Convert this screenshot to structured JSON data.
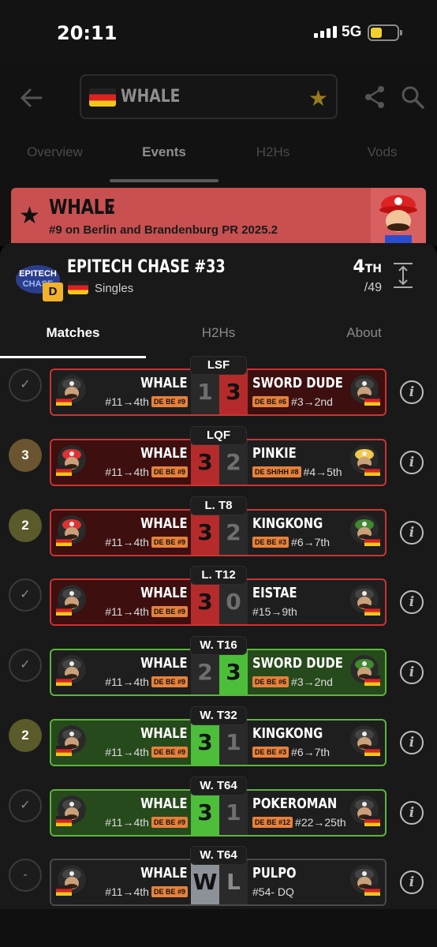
{
  "status": {
    "time": "20:11",
    "network": "5G"
  },
  "header": {
    "search_text": "WHALE",
    "tabs": [
      "Overview",
      "Events",
      "H2Hs",
      "Vods"
    ],
    "active_tab": 1
  },
  "banner": {
    "name": "WHALE",
    "subtitle": "#9 on Berlin and Brandenburg PR 2025.2"
  },
  "event": {
    "title": "EPITECH CHASE #33",
    "tier": "D",
    "type": "Singles",
    "placement": "4",
    "placement_suffix": "TH",
    "entrants": "/49",
    "tabs": [
      "Matches",
      "H2Hs",
      "About"
    ]
  },
  "colors": {
    "loss": "#b52b2b",
    "win": "#4cbe3a",
    "pr_badge": "#e8813a",
    "tier_badge": "#f0b22b"
  },
  "matches": [
    {
      "round": "LSF",
      "status": "check",
      "left": {
        "name": "WHALE",
        "pr": "DE BE #9",
        "seed": "#11→4th"
      },
      "score_left": "1",
      "score_right": "3",
      "right": {
        "name": "SWORD DUDE",
        "pr": "DE BE #6",
        "seed": "#3→2nd"
      }
    },
    {
      "round": "LQF",
      "status": "3",
      "left": {
        "name": "WHALE",
        "pr": "DE BE #9",
        "seed": "#11→4th"
      },
      "score_left": "3",
      "score_right": "2",
      "right": {
        "name": "PINKIE",
        "pr": "DE SH/HH #8",
        "seed": "#4→5th"
      }
    },
    {
      "round": "L. T8",
      "status": "2",
      "left": {
        "name": "WHALE",
        "pr": "DE BE #9",
        "seed": "#11→4th"
      },
      "score_left": "3",
      "score_right": "2",
      "right": {
        "name": "KINGKONG",
        "pr": "DE BE #3",
        "seed": "#6→7th"
      }
    },
    {
      "round": "L. T12",
      "status": "check",
      "left": {
        "name": "WHALE",
        "pr": "DE BE #9",
        "seed": "#11→4th"
      },
      "score_left": "3",
      "score_right": "0",
      "right": {
        "name": "EISTAE",
        "pr": "",
        "seed": "#15→9th"
      }
    },
    {
      "round": "W. T16",
      "status": "check",
      "left": {
        "name": "WHALE",
        "pr": "DE BE #9",
        "seed": "#11→4th"
      },
      "score_left": "2",
      "score_right": "3",
      "right": {
        "name": "SWORD DUDE",
        "pr": "DE BE #6",
        "seed": "#3→2nd"
      }
    },
    {
      "round": "W. T32",
      "status": "2",
      "left": {
        "name": "WHALE",
        "pr": "DE BE #9",
        "seed": "#11→4th"
      },
      "score_left": "3",
      "score_right": "1",
      "right": {
        "name": "KINGKONG",
        "pr": "DE BE #3",
        "seed": "#6→7th"
      }
    },
    {
      "round": "W. T64",
      "status": "check",
      "left": {
        "name": "WHALE",
        "pr": "DE BE #9",
        "seed": "#11→4th"
      },
      "score_left": "3",
      "score_right": "1",
      "right": {
        "name": "POKEROMAN",
        "pr": "DE BE #12",
        "seed": "#22→25th"
      }
    },
    {
      "round": "W. T64",
      "status": "-",
      "left": {
        "name": "WHALE",
        "pr": "DE BE #9",
        "seed": "#11→4th"
      },
      "score_left": "W",
      "score_right": "L",
      "right": {
        "name": "PULPO",
        "pr": "",
        "seed": "#54- DQ"
      }
    }
  ]
}
